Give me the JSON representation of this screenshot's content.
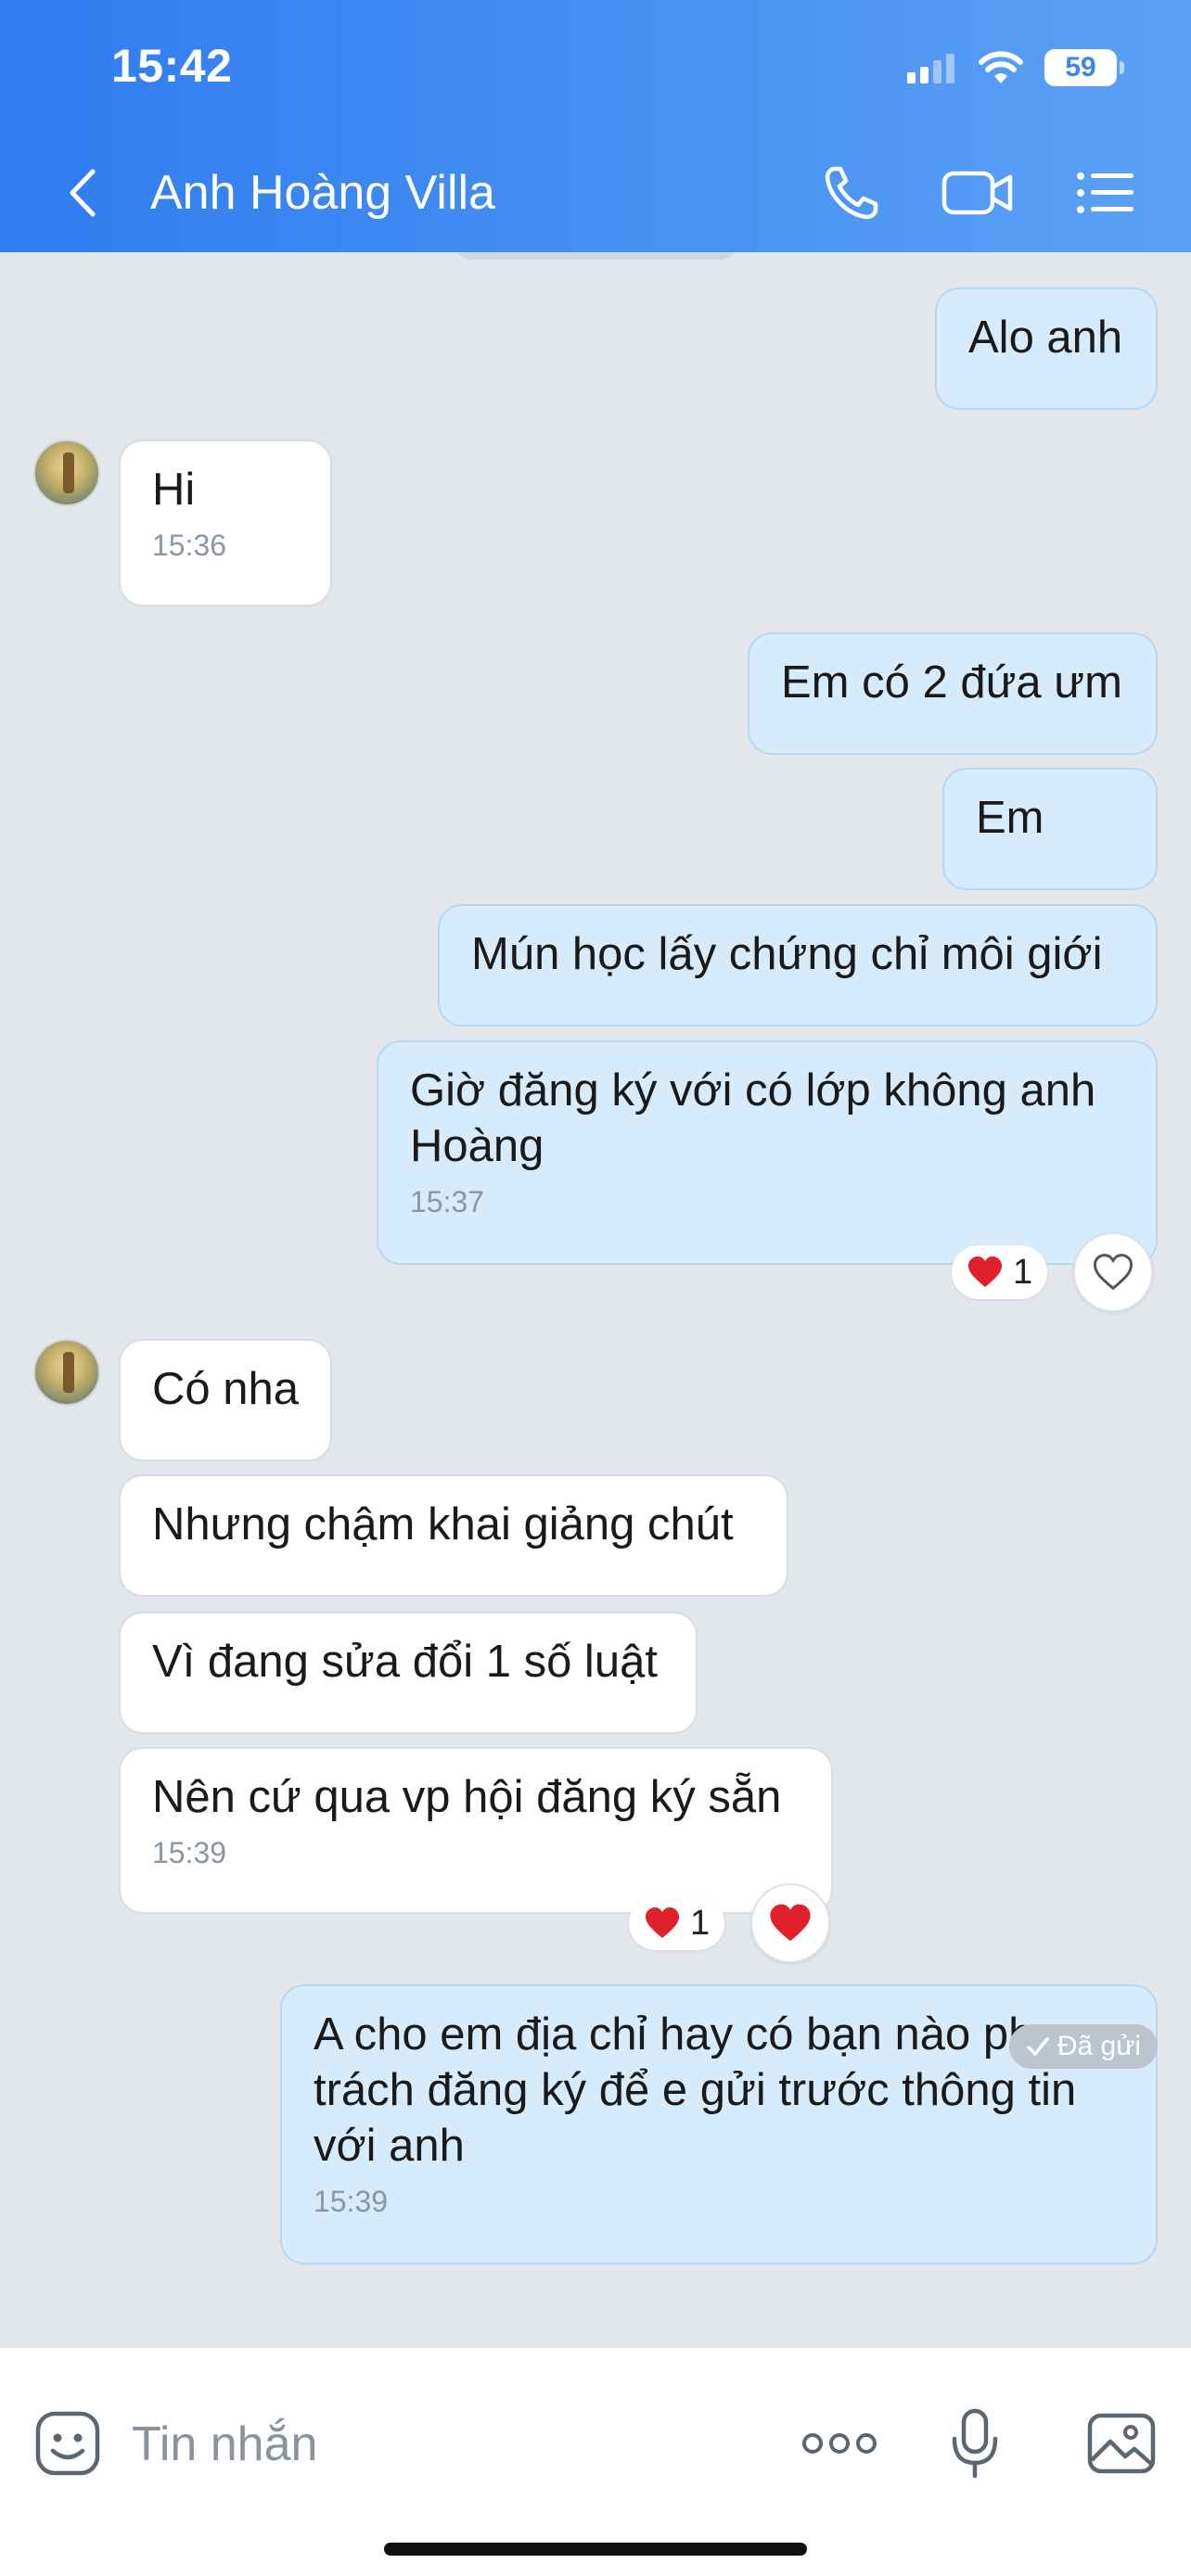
{
  "status_bar": {
    "time": "15:42",
    "battery": "59"
  },
  "header": {
    "title": "Anh Hoàng Villa"
  },
  "messages": [
    {
      "side": "me",
      "text": "Alo anh"
    },
    {
      "side": "them",
      "text": "Hi",
      "time": "15:36"
    },
    {
      "side": "me",
      "text": "Em có 2 đứa ưm"
    },
    {
      "side": "me",
      "text": "Em"
    },
    {
      "side": "me",
      "text": "Mún học lấy chứng chỉ môi giới"
    },
    {
      "side": "me",
      "text": "Giờ đăng ký với có lớp không anh Hoàng",
      "time": "15:37",
      "reaction": {
        "icon": "heart",
        "count": "1"
      }
    },
    {
      "side": "them",
      "text": "Có nha"
    },
    {
      "side": "them",
      "text": "Nhưng chậm khai giảng chút"
    },
    {
      "side": "them",
      "text": "Vì đang sửa đổi 1 số luật"
    },
    {
      "side": "them",
      "text": "Nên cứ qua vp hội đăng ký sẵn",
      "time": "15:39",
      "reaction": {
        "icon": "heart",
        "count": "1"
      }
    },
    {
      "side": "me",
      "text": "A cho em địa chỉ hay có bạn nào phụ trách đăng ký để e gửi trước thông tin với anh",
      "time": "15:39"
    }
  ],
  "sent_status": "Đã gửi",
  "composer": {
    "placeholder": "Tin nhắn"
  },
  "colors": {
    "header_start": "#2f7cf0",
    "header_end": "#5aa2f5",
    "my_bubble": "#d6ecfc",
    "their_bubble": "#ffffff",
    "chat_bg": "#e3e7ec",
    "heart": "#e0202a"
  },
  "icons": [
    "back-icon",
    "phone-icon",
    "video-call-icon",
    "menu-list-icon",
    "sticker-icon",
    "more-icon",
    "microphone-icon",
    "image-icon",
    "heart-icon",
    "checkmark-icon"
  ]
}
